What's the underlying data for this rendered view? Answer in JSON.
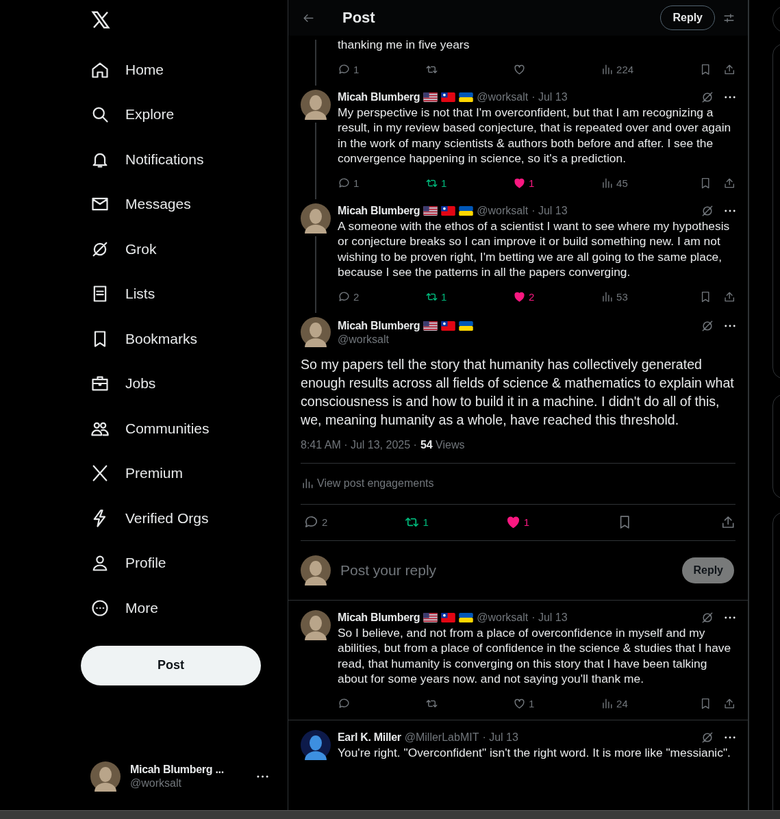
{
  "sidebar": {
    "nav_items": [
      {
        "label": "Home"
      },
      {
        "label": "Explore"
      },
      {
        "label": "Notifications"
      },
      {
        "label": "Messages"
      },
      {
        "label": "Grok"
      },
      {
        "label": "Lists"
      },
      {
        "label": "Bookmarks"
      },
      {
        "label": "Jobs"
      },
      {
        "label": "Communities"
      },
      {
        "label": "Premium"
      },
      {
        "label": "Verified Orgs"
      },
      {
        "label": "Profile"
      },
      {
        "label": "More"
      }
    ],
    "post_button": "Post",
    "account": {
      "name": "Micah Blumberg ...",
      "handle": "@worksalt"
    }
  },
  "header": {
    "title": "Post",
    "reply_button": "Reply"
  },
  "thread": [
    {
      "text": "thanking me in five years",
      "replies": "1",
      "views": "224",
      "reposted": false,
      "liked": false
    },
    {
      "name": "Micah Blumberg",
      "show_flags": true,
      "handle": "@worksalt",
      "date": "· Jul 13",
      "text": "My perspective is not that I'm overconfident, but that I am recognizing a result, in my review based conjecture, that is repeated over and over again in the work of many scientists & authors both before and after. I see the convergence happening in science, so it's a prediction.",
      "replies": "1",
      "reposts": "1",
      "likes": "1",
      "views": "45",
      "reposted": true,
      "liked": true
    },
    {
      "name": "Micah Blumberg",
      "show_flags": true,
      "handle": "@worksalt",
      "date": "· Jul 13",
      "text": "A someone with the ethos of a scientist I want to see where my hypothesis or conjecture breaks so I can improve it or build something new. I am not wishing to be proven right, I'm betting we are all going to the same place, because I see the patterns in all the papers converging.",
      "replies": "2",
      "reposts": "1",
      "likes": "2",
      "views": "53",
      "reposted": true,
      "liked": true
    }
  ],
  "main_post": {
    "name": "Micah Blumberg",
    "show_flags": true,
    "handle": "@worksalt",
    "text": "So my papers tell the story that humanity has collectively generated enough results across all fields of science & mathematics to explain what consciousness is and how to build it in a machine. I didn't do all of this, we, meaning humanity as a whole, have reached this threshold.",
    "timestamp": "8:41 AM · Jul 13, 2025 ·",
    "views_count": "54",
    "views_label": "Views",
    "engagements": "View post engagements",
    "replies": "2",
    "reposts": "1",
    "likes": "1",
    "reposted": true,
    "liked": true
  },
  "reply_box": {
    "placeholder": "Post your reply",
    "button": "Reply",
    "disabled": true
  },
  "replies": [
    {
      "name": "Micah Blumberg",
      "show_flags": true,
      "handle": "@worksalt",
      "date": "· Jul 13",
      "text": "So I believe, and not from a place of overconfidence in myself and my abilities, but from a place of confidence in the science & studies that I have read, that humanity is converging on this story that I have been talking about for some years now. and not saying you'll thank me.",
      "likes": "1",
      "views": "24",
      "reposted": false,
      "liked": false
    },
    {
      "name": "Earl K. Miller",
      "show_flags": false,
      "handle": "@MillerLabMIT",
      "date": "· Jul 13",
      "text": "You're right. \"Overconfident\" isn't the right word.  It is more like \"messianic\"."
    }
  ]
}
